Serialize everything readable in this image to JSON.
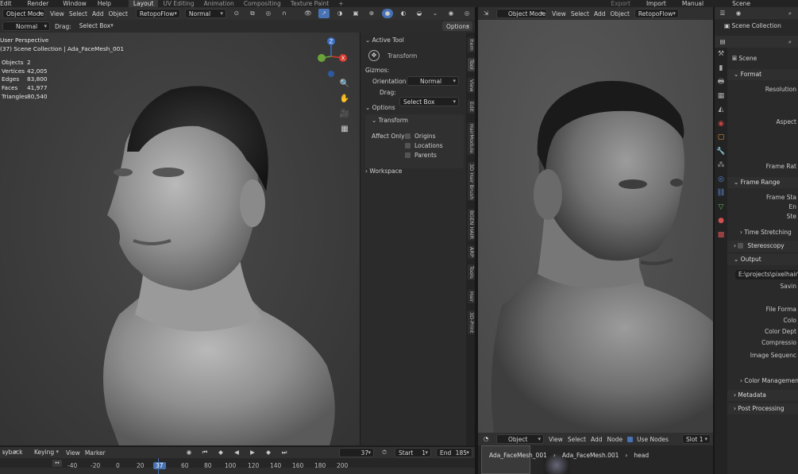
{
  "top_menu": [
    "Edit",
    "Render",
    "Window",
    "Help"
  ],
  "workspaces": [
    "Layout",
    "UV Editing",
    "Animation",
    "Compositing",
    "Texture Paint",
    "+"
  ],
  "top_right": {
    "export": "Export",
    "import": "Import",
    "manual": "Manual",
    "scene": "Scene"
  },
  "left_header": {
    "mode": "Object Mode",
    "menus": [
      "View",
      "Select",
      "Add",
      "Object"
    ],
    "retopo": "RetopoFlow",
    "orientation": "Normal"
  },
  "left_toolrow": {
    "orientation": "Normal",
    "drag_label": "Drag:",
    "drag_value": "Select Box",
    "options": "Options"
  },
  "overlay": {
    "perspective": "User Perspective",
    "collection": "(37) Scene Collection | Ada_FaceMesh_001"
  },
  "stats": [
    {
      "label": "Objects",
      "value": "2"
    },
    {
      "label": "Vertices",
      "value": "42,005"
    },
    {
      "label": "Edges",
      "value": "83,800"
    },
    {
      "label": "Faces",
      "value": "41,977"
    },
    {
      "label": "Triangles",
      "value": "80,540"
    }
  ],
  "npanel": {
    "active_tool": "Active Tool",
    "transform": "Transform",
    "gizmos": "Gizmos:",
    "orientation_label": "Orientation",
    "orientation_value": "Normal",
    "drag_label": "Drag:",
    "drag_value": "Select Box",
    "options": "Options",
    "transform_sub": "Transform",
    "affect_only": "Affect Only",
    "origins": "Origins",
    "locations": "Locations",
    "parents": "Parents",
    "workspace": "Workspace"
  },
  "vtabs": [
    "Item",
    "Tool",
    "View",
    "Edit",
    "HairModule",
    "3D Hair Brush",
    "BGEN HAIR",
    "ARP",
    "Tools",
    "Hair",
    "3D-Print"
  ],
  "right_header": {
    "mode": "Object Mode",
    "menus": [
      "View",
      "Select",
      "Add",
      "Object"
    ],
    "retopo": "RetopoFlow"
  },
  "node_header": {
    "type": "Object",
    "menus": [
      "View",
      "Select",
      "Add",
      "Node"
    ],
    "use_nodes": "Use Nodes",
    "slot": "Slot 1"
  },
  "node_breadcrumb": [
    "Ada_FaceMesh_001",
    "Ada_FaceMesh.001",
    "head"
  ],
  "outliner": {
    "scene_collection": "Scene Collection"
  },
  "properties": {
    "scene": "Scene",
    "format": "Format",
    "resolution": "Resolution",
    "aspect": "Aspect",
    "frame_rate": "Frame Rat",
    "frame_range": "Frame Range",
    "frame_start": "Frame Sta",
    "end": "En",
    "step": "Ste",
    "time_stretching": "Time Stretching",
    "stereoscopy": "Stereoscopy",
    "output": "Output",
    "path": "E:\\projects\\pixelhair\\m",
    "saving": "Savin",
    "file_format": "File Forma",
    "color": "Colo",
    "color_depth": "Color Dept",
    "compression": "Compressio",
    "image_sequence": "Image Sequenc",
    "color_management": "Color Managemen",
    "metadata": "Metadata",
    "post_processing": "Post Processing"
  },
  "timeline": {
    "playback": "Playback",
    "keying": "Keying",
    "view": "View",
    "marker": "Marker",
    "current_frame": "37",
    "start_label": "Start",
    "start_value": "1",
    "end_label": "End",
    "end_value": "185",
    "ticks": [
      "-40",
      "-20",
      "0",
      "20",
      "37",
      "60",
      "80",
      "100",
      "120",
      "140",
      "160",
      "180",
      "200"
    ]
  },
  "colors": {
    "accent": "#4772b3",
    "x_axis": "#d4392f",
    "y_axis": "#6aa33a",
    "z_axis": "#3a6fc4"
  }
}
